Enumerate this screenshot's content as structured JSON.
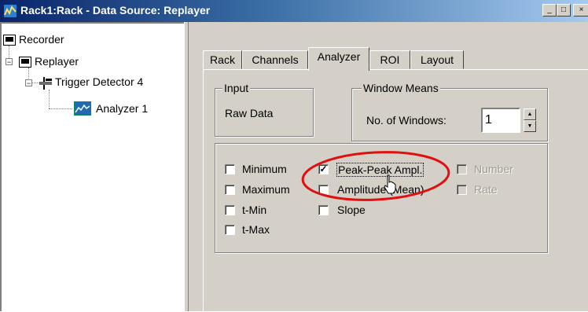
{
  "window": {
    "title": "Rack1:Rack - Data Source: Replayer",
    "minimize": "_",
    "maximize": "□",
    "close": "×"
  },
  "tree": {
    "items": [
      {
        "label": "Recorder",
        "icon": "recorder-icon"
      },
      {
        "label": "Replayer",
        "icon": "recorder-icon"
      },
      {
        "label": "Trigger Detector 4",
        "icon": "trigger-icon"
      },
      {
        "label": "Analyzer 1",
        "icon": "analyzer-icon"
      }
    ]
  },
  "tabs": [
    {
      "label": "Rack"
    },
    {
      "label": "Channels"
    },
    {
      "label": "Analyzer",
      "active": true
    },
    {
      "label": "ROI"
    },
    {
      "label": "Layout"
    }
  ],
  "input_group": {
    "title": "Input",
    "value": "Raw Data"
  },
  "window_means": {
    "title": "Window Means",
    "label": "No. of Windows:",
    "value": "1"
  },
  "checkboxes": {
    "col1": [
      {
        "label": "Minimum",
        "checked": false
      },
      {
        "label": "Maximum",
        "checked": false
      },
      {
        "label": "t-Min",
        "checked": false
      },
      {
        "label": "t-Max",
        "checked": false
      }
    ],
    "col2": [
      {
        "label": "Peak-Peak Ampl.",
        "checked": true
      },
      {
        "label": "Amplitude (Mean)",
        "checked": false
      },
      {
        "label": "Slope",
        "checked": false
      }
    ],
    "col3": [
      {
        "label": "Number",
        "checked": false,
        "disabled": true
      },
      {
        "label": "Rate",
        "checked": false,
        "disabled": true
      }
    ]
  },
  "highlight_color": "#e01010"
}
